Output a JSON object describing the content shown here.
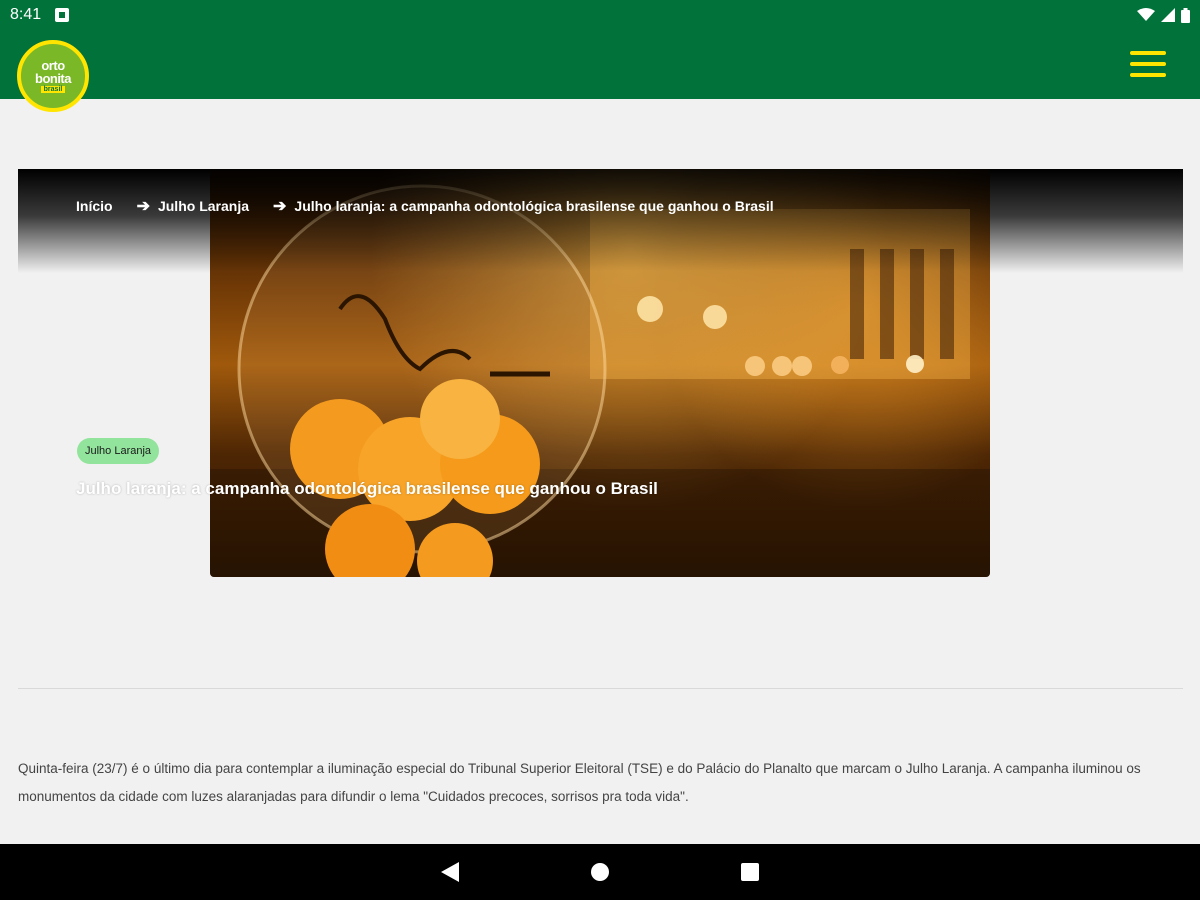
{
  "status_bar": {
    "time": "8:41",
    "icons": [
      "notification-icon",
      "wifi-icon",
      "signal-icon",
      "battery-icon"
    ]
  },
  "app_bar": {
    "logo": {
      "line1": "orto",
      "line2": "bonita",
      "line3": "brasil"
    },
    "menu_icon": "hamburger-menu-icon",
    "accent": "#ffe500",
    "background": "#01723a"
  },
  "hero": {
    "breadcrumb": {
      "home": "Início",
      "category": "Julho Laranja",
      "current": "Julho laranja: a campanha odontológica brasilense que ganhou o Brasil",
      "separator_icon": "arrow-right-icon"
    },
    "tag": "Julho Laranja",
    "tag_color": "#92e39c",
    "title": "Julho laranja: a campanha odontológica brasilense que ganhou o Brasil"
  },
  "article": {
    "intro": "Quinta-feira (23/7) é o último dia para contemplar a iluminação especial do Tribunal Superior Eleitoral (TSE) e do Palácio do Planalto que marcam o Julho Laranja. A campanha iluminou os monumentos da cidade com luzes alaranjadas para difundir o lema \"Cuidados precoces, sorrisos pra toda vida\"."
  },
  "nav_bar": {
    "buttons": [
      "back-icon",
      "home-icon",
      "recents-icon"
    ]
  }
}
